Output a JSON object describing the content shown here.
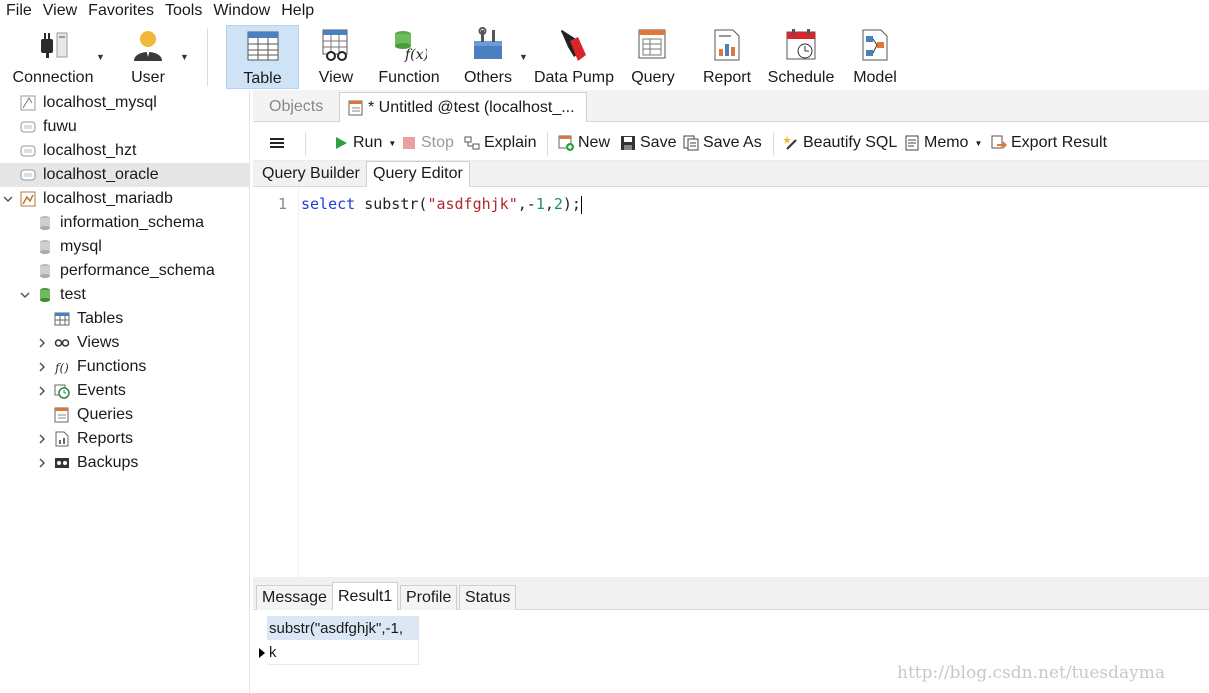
{
  "menu": [
    "File",
    "View",
    "Favorites",
    "Tools",
    "Window",
    "Help"
  ],
  "toolbar": {
    "connection": "Connection",
    "user": "User",
    "table": "Table",
    "view": "View",
    "function": "Function",
    "others": "Others",
    "data_pump": "Data Pump",
    "query": "Query",
    "report": "Report",
    "schedule": "Schedule",
    "model": "Model"
  },
  "sidebar": {
    "connections": [
      "localhost_mysql",
      "fuwu",
      "localhost_hzt",
      "localhost_oracle",
      "localhost_mariadb"
    ],
    "databases": [
      "information_schema",
      "mysql",
      "performance_schema",
      "test"
    ],
    "objects": [
      "Tables",
      "Views",
      "Functions",
      "Events",
      "Queries",
      "Reports",
      "Backups"
    ]
  },
  "tabs": {
    "objects": "Objects",
    "query": "* Untitled @test (localhost_..."
  },
  "query_toolbar": {
    "run": "Run",
    "stop": "Stop",
    "explain": "Explain",
    "new": "New",
    "save": "Save",
    "save_as": "Save As",
    "beautify": "Beautify SQL",
    "memo": "Memo",
    "export": "Export Result"
  },
  "subtabs": [
    "Query Builder",
    "Query Editor"
  ],
  "editor": {
    "line_number": "1",
    "keyword": "select",
    "func": " substr(",
    "string": "\"asdfghjk\"",
    "comma1": ",-",
    "num1": "1",
    "comma2": ",",
    "num2": "2",
    "tail": ");"
  },
  "result_tabs": [
    "Message",
    "Result1",
    "Profile",
    "Status"
  ],
  "result": {
    "column": "substr(\"asdfghjk\",-1,",
    "value": "k"
  },
  "watermark": "http://blog.csdn.net/tuesdayma",
  "colors": {
    "selection": "#cfe3f7",
    "keyword": "#1c3fd8",
    "string": "#b0282a",
    "number": "#1c8c74",
    "run_green": "#2ea043"
  }
}
